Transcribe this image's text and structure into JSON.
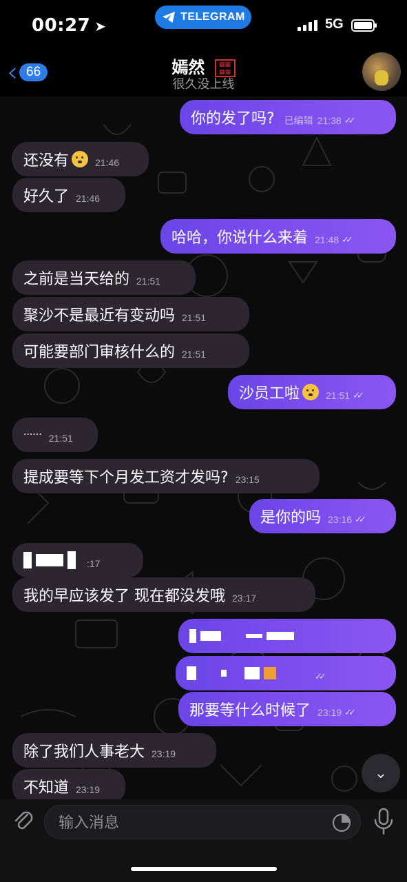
{
  "status": {
    "time": "00:27",
    "app_pill": "TELEGRAM",
    "network": "5G"
  },
  "header": {
    "back_count": "66",
    "name": "嫣然",
    "status": "很久没上线"
  },
  "messages": [
    {
      "text": "你的发了吗?",
      "edited": "已编辑",
      "time": "21:38"
    },
    {
      "text": "还没有",
      "time": "21:46"
    },
    {
      "text": "好久了",
      "time": "21:46"
    },
    {
      "text": "哈哈，你说什么来着",
      "time": "21:48"
    },
    {
      "text": "之前是当天给的",
      "time": "21:51"
    },
    {
      "text": "聚沙不是最近有变动吗",
      "time": "21:51"
    },
    {
      "text": "可能要部门审核什么的",
      "time": "21:51"
    },
    {
      "text": "沙员工啦",
      "time": "21:51"
    },
    {
      "text": "······",
      "time": "21:51"
    },
    {
      "text": "提成要等下个月发工资才发吗?",
      "time": "23:15"
    },
    {
      "text": "是你的吗",
      "time": "23:16"
    },
    {
      "text": "",
      "time": ":17"
    },
    {
      "text": "我的早应该发了  现在都没发哦",
      "time": "23:17"
    },
    {
      "text": "",
      "time": ""
    },
    {
      "text": "",
      "time": ""
    },
    {
      "text": "那要等什么时候了",
      "time": "23:19"
    },
    {
      "text": "除了我们人事老大",
      "time": "23:19"
    },
    {
      "text": "不知道",
      "time": "23:19"
    }
  ],
  "input": {
    "placeholder": "输入消息"
  },
  "icons": [
    "location-arrow-icon",
    "telegram-icon",
    "signal-icon",
    "battery-icon",
    "back-chevron-icon",
    "seal-icon",
    "avatar",
    "double-check-icon",
    "emoji-flushed-icon",
    "emoji-laughing-icon",
    "chevron-down-icon",
    "attachment-clip-icon",
    "sticker-icon",
    "microphone-icon"
  ],
  "colors": {
    "accent": "#1E7BE6",
    "outgoing": "#7A4EED",
    "incoming": "#2B2630"
  }
}
